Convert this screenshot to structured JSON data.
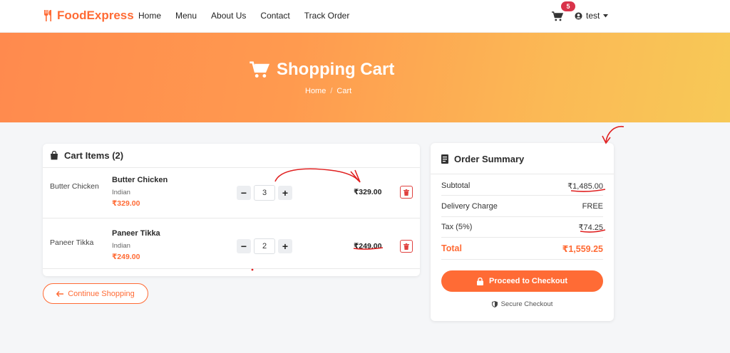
{
  "navbar": {
    "brand": "FoodExpress",
    "links": [
      "Home",
      "Menu",
      "About Us",
      "Contact",
      "Track Order"
    ],
    "cart_count": "5",
    "user": "test"
  },
  "hero": {
    "title": "Shopping Cart",
    "breadcrumb": [
      "Home",
      "/",
      "Cart"
    ]
  },
  "cart": {
    "title": "Cart Items (2)",
    "items": [
      {
        "image_alt": "Butter Chicken",
        "name": "Butter Chicken",
        "category": "Indian",
        "price": "₹329.00",
        "qty": "3",
        "total": "₹329.00"
      },
      {
        "image_alt": "Paneer Tikka",
        "name": "Paneer Tikka",
        "category": "Indian",
        "price": "₹249.00",
        "qty": "2",
        "total": "₹249.00"
      }
    ],
    "continue_label": "Continue Shopping"
  },
  "summary": {
    "title": "Order Summary",
    "subtotal_label": "Subtotal",
    "subtotal": "₹1,485.00",
    "delivery_label": "Delivery Charge",
    "delivery": "FREE",
    "tax_label": "Tax (5%)",
    "tax": "₹74.25",
    "total_label": "Total",
    "total": "₹1,559.25",
    "checkout_label": "Proceed to Checkout",
    "secure_label": "Secure Checkout"
  },
  "colors": {
    "brand": "#ff6b35",
    "badge": "#d9334a",
    "annotation": "#e02020"
  }
}
